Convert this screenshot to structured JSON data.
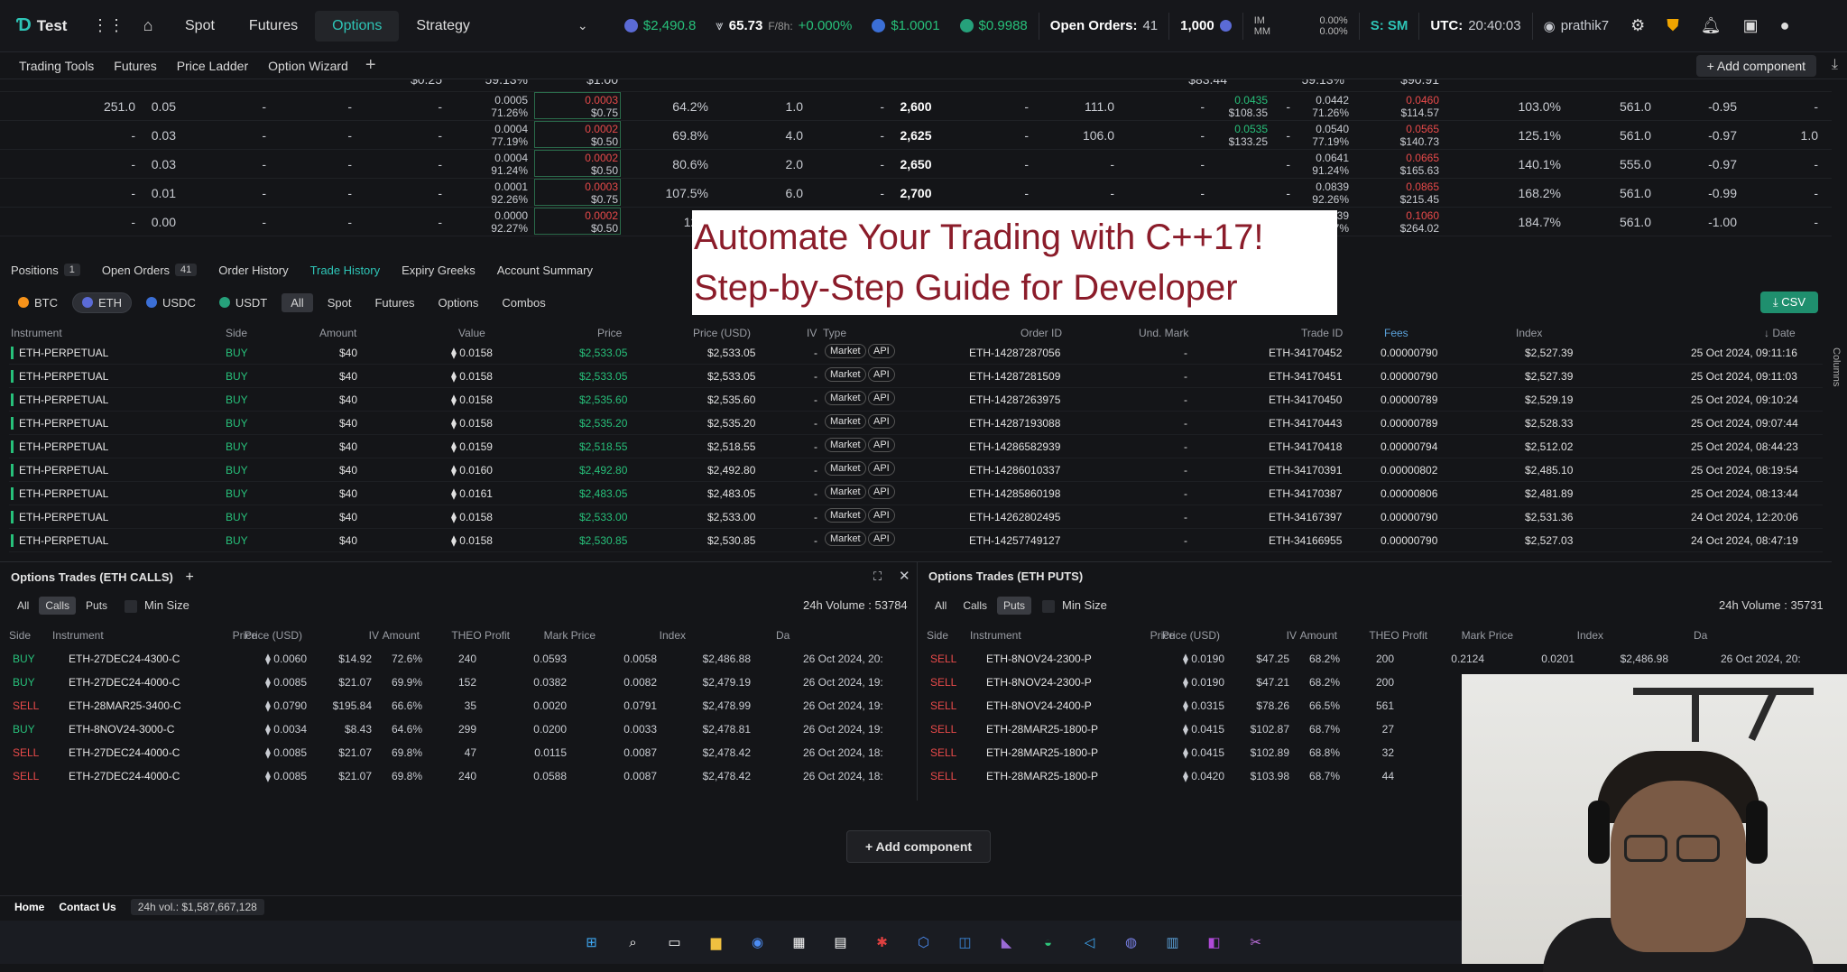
{
  "nav": {
    "logo": "Test",
    "links": [
      "Spot",
      "Futures",
      "Options",
      "Strategy"
    ],
    "active": "Options",
    "tickers": {
      "btc_price": "$2,490.8",
      "funding_label": "65.73",
      "funding_rate_label": "F/8h:",
      "funding_rate": "+0.000%",
      "usdc": "$1.0001",
      "usdt": "$0.9988"
    },
    "open_orders_label": "Open Orders:",
    "open_orders": "41",
    "size": "1,000",
    "im_label": "IM",
    "mm_label": "MM",
    "im": "0.00%",
    "mm": "0.00%",
    "s_label": "S: SM",
    "utc_label": "UTC:",
    "utc": "20:40:03",
    "user": "prathik7"
  },
  "toolbar": {
    "items": [
      "Trading Tools",
      "Futures",
      "Price Ladder",
      "Option Wizard"
    ],
    "add_component": "Add component"
  },
  "chain_rows": [
    {
      "bid_sz": "251.0",
      "bid": "0.05",
      "a": "-",
      "b": "-",
      "c": "-",
      "mark": "0.0005",
      "mark_iv": "71.26%",
      "ask": "0.0003",
      "ask_usd": "$0.75",
      "iv": "64.2%",
      "oi": "1.0",
      "d": "-",
      "strike": "2,600",
      "p1": "-",
      "p2": "111.0",
      "p3": "-",
      "p4": "-",
      "pbid": "0.0435",
      "pbid_usd": "$108.35",
      "pmark": "0.0442",
      "pmark_iv": "71.26%",
      "pask": "0.0460",
      "pask_usd": "$114.57",
      "piv": "103.0%",
      "poi": "561.0",
      "pdelta": "-0.95",
      "pe": "-"
    },
    {
      "bid_sz": "-",
      "bid": "0.03",
      "a": "-",
      "b": "-",
      "c": "-",
      "mark": "0.0004",
      "mark_iv": "77.19%",
      "ask": "0.0002",
      "ask_usd": "$0.50",
      "iv": "69.8%",
      "oi": "4.0",
      "d": "-",
      "strike": "2,625",
      "p1": "-",
      "p2": "106.0",
      "p3": "-",
      "p4": "-",
      "pbid": "0.0535",
      "pbid_usd": "$133.25",
      "pmark": "0.0540",
      "pmark_iv": "77.19%",
      "pask": "0.0565",
      "pask_usd": "$140.73",
      "piv": "125.1%",
      "poi": "561.0",
      "pdelta": "-0.97",
      "pe": "1.0"
    },
    {
      "bid_sz": "-",
      "bid": "0.03",
      "a": "-",
      "b": "-",
      "c": "-",
      "mark": "0.0004",
      "mark_iv": "91.24%",
      "ask": "0.0002",
      "ask_usd": "$0.50",
      "iv": "80.6%",
      "oi": "2.0",
      "d": "-",
      "strike": "2,650",
      "p1": "-",
      "p2": "-",
      "p3": "-",
      "p4": "-",
      "pbid": "",
      "pbid_usd": "",
      "pmark": "0.0641",
      "pmark_iv": "91.24%",
      "pask": "0.0665",
      "pask_usd": "$165.63",
      "piv": "140.1%",
      "poi": "555.0",
      "pdelta": "-0.97",
      "pe": "-"
    },
    {
      "bid_sz": "-",
      "bid": "0.01",
      "a": "-",
      "b": "-",
      "c": "-",
      "mark": "0.0001",
      "mark_iv": "92.26%",
      "ask": "0.0003",
      "ask_usd": "$0.75",
      "iv": "107.5%",
      "oi": "6.0",
      "d": "-",
      "strike": "2,700",
      "p1": "-",
      "p2": "-",
      "p3": "-",
      "p4": "-",
      "pbid": "",
      "pbid_usd": "",
      "pmark": "0.0839",
      "pmark_iv": "92.26%",
      "pask": "0.0865",
      "pask_usd": "$215.45",
      "piv": "168.2%",
      "poi": "561.0",
      "pdelta": "-0.99",
      "pe": "-"
    },
    {
      "bid_sz": "-",
      "bid": "0.00",
      "a": "-",
      "b": "-",
      "c": "-",
      "mark": "0.0000",
      "mark_iv": "92.27%",
      "ask": "0.0002",
      "ask_usd": "$0.50",
      "iv": "120.",
      "oi": "",
      "d": "",
      "strike": "",
      "p1": "",
      "p2": "",
      "p3": "",
      "p4": "",
      "pbid": "",
      "pbid_usd": "",
      "pmark": "0.1039",
      "pmark_iv": "92.27%",
      "pask": "0.1060",
      "pask_usd": "$264.02",
      "piv": "184.7%",
      "poi": "561.0",
      "pdelta": "-1.00",
      "pe": "-"
    }
  ],
  "chain_top_partial": {
    "a": "$0.25",
    "b": "59.13%",
    "c": "$1.00",
    "d": "$83.44",
    "e": "59.13%",
    "f": "$90.91"
  },
  "banner": {
    "line1": "Automate Your Trading with C++17!",
    "line2": "Step-by-Step Guide for Developer"
  },
  "panel_tabs": [
    {
      "label": "Positions",
      "badge": "1"
    },
    {
      "label": "Open Orders",
      "badge": "41"
    },
    {
      "label": "Order History"
    },
    {
      "label": "Trade History",
      "active": true
    },
    {
      "label": "Expiry Greeks"
    },
    {
      "label": "Account Summary"
    }
  ],
  "coin_chips": [
    "BTC",
    "ETH",
    "USDC",
    "USDT"
  ],
  "type_chips": [
    "All",
    "Spot",
    "Futures",
    "Options",
    "Combos"
  ],
  "csv_label": "CSV",
  "th_headers": {
    "instrument": "Instrument",
    "side": "Side",
    "amount": "Amount",
    "value": "Value",
    "price": "Price",
    "price_usd": "Price (USD)",
    "iv": "IV",
    "type": "Type",
    "order_id": "Order ID",
    "und_mark": "Und. Mark",
    "trade_id": "Trade ID",
    "fees": "Fees",
    "index": "Index",
    "date": "Date",
    "columns": "Columns"
  },
  "trades": [
    {
      "inst": "ETH-PERPETUAL",
      "side": "BUY",
      "amt": "$40",
      "val": "0.0158",
      "price": "$2,533.05",
      "usd": "$2,533.05",
      "iv": "-",
      "type": "Market",
      "api": "API",
      "oid": "ETH-14287287056",
      "und": "-",
      "tid": "ETH-34170452",
      "fees": "0.00000790",
      "index": "$2,527.39",
      "date": "25 Oct 2024, 09:11:16"
    },
    {
      "inst": "ETH-PERPETUAL",
      "side": "BUY",
      "amt": "$40",
      "val": "0.0158",
      "price": "$2,533.05",
      "usd": "$2,533.05",
      "iv": "-",
      "type": "Market",
      "api": "API",
      "oid": "ETH-14287281509",
      "und": "-",
      "tid": "ETH-34170451",
      "fees": "0.00000790",
      "index": "$2,527.39",
      "date": "25 Oct 2024, 09:11:03"
    },
    {
      "inst": "ETH-PERPETUAL",
      "side": "BUY",
      "amt": "$40",
      "val": "0.0158",
      "price": "$2,535.60",
      "usd": "$2,535.60",
      "iv": "-",
      "type": "Market",
      "api": "API",
      "oid": "ETH-14287263975",
      "und": "-",
      "tid": "ETH-34170450",
      "fees": "0.00000789",
      "index": "$2,529.19",
      "date": "25 Oct 2024, 09:10:24"
    },
    {
      "inst": "ETH-PERPETUAL",
      "side": "BUY",
      "amt": "$40",
      "val": "0.0158",
      "price": "$2,535.20",
      "usd": "$2,535.20",
      "iv": "-",
      "type": "Market",
      "api": "API",
      "oid": "ETH-14287193088",
      "und": "-",
      "tid": "ETH-34170443",
      "fees": "0.00000789",
      "index": "$2,528.33",
      "date": "25 Oct 2024, 09:07:44"
    },
    {
      "inst": "ETH-PERPETUAL",
      "side": "BUY",
      "amt": "$40",
      "val": "0.0159",
      "price": "$2,518.55",
      "usd": "$2,518.55",
      "iv": "-",
      "type": "Market",
      "api": "API",
      "oid": "ETH-14286582939",
      "und": "-",
      "tid": "ETH-34170418",
      "fees": "0.00000794",
      "index": "$2,512.02",
      "date": "25 Oct 2024, 08:44:23"
    },
    {
      "inst": "ETH-PERPETUAL",
      "side": "BUY",
      "amt": "$40",
      "val": "0.0160",
      "price": "$2,492.80",
      "usd": "$2,492.80",
      "iv": "-",
      "type": "Market",
      "api": "API",
      "oid": "ETH-14286010337",
      "und": "-",
      "tid": "ETH-34170391",
      "fees": "0.00000802",
      "index": "$2,485.10",
      "date": "25 Oct 2024, 08:19:54"
    },
    {
      "inst": "ETH-PERPETUAL",
      "side": "BUY",
      "amt": "$40",
      "val": "0.0161",
      "price": "$2,483.05",
      "usd": "$2,483.05",
      "iv": "-",
      "type": "Market",
      "api": "API",
      "oid": "ETH-14285860198",
      "und": "-",
      "tid": "ETH-34170387",
      "fees": "0.00000806",
      "index": "$2,481.89",
      "date": "25 Oct 2024, 08:13:44"
    },
    {
      "inst": "ETH-PERPETUAL",
      "side": "BUY",
      "amt": "$40",
      "val": "0.0158",
      "price": "$2,533.00",
      "usd": "$2,533.00",
      "iv": "-",
      "type": "Market",
      "api": "API",
      "oid": "ETH-14262802495",
      "und": "-",
      "tid": "ETH-34167397",
      "fees": "0.00000790",
      "index": "$2,531.36",
      "date": "24 Oct 2024, 12:20:06"
    },
    {
      "inst": "ETH-PERPETUAL",
      "side": "BUY",
      "amt": "$40",
      "val": "0.0158",
      "price": "$2,530.85",
      "usd": "$2,530.85",
      "iv": "-",
      "type": "Market",
      "api": "API",
      "oid": "ETH-14257749127",
      "und": "-",
      "tid": "ETH-34166955",
      "fees": "0.00000790",
      "index": "$2,527.03",
      "date": "24 Oct 2024, 08:47:19"
    }
  ],
  "calls_panel": {
    "title": "Options Trades (ETH CALLS)",
    "seg": [
      "All",
      "Calls",
      "Puts"
    ],
    "selected": "Calls",
    "min_size": "Min Size",
    "vol": "24h Volume : 53784",
    "headers": [
      "Side",
      "Instrument",
      "Price",
      "Price (USD)",
      "IV",
      "Amount",
      "THEO Profit",
      "Mark Price",
      "Index",
      "Da"
    ],
    "rows": [
      [
        "BUY",
        "ETH-27DEC24-4300-C",
        "0.0060",
        "$14.92",
        "72.6%",
        "240",
        "0.0593",
        "0.0058",
        "$2,486.88",
        "26 Oct 2024, 20:"
      ],
      [
        "BUY",
        "ETH-27DEC24-4000-C",
        "0.0085",
        "$21.07",
        "69.9%",
        "152",
        "0.0382",
        "0.0082",
        "$2,479.19",
        "26 Oct 2024, 19:"
      ],
      [
        "SELL",
        "ETH-28MAR25-3400-C",
        "0.0790",
        "$195.84",
        "66.6%",
        "35",
        "0.0020",
        "0.0791",
        "$2,478.99",
        "26 Oct 2024, 19:"
      ],
      [
        "BUY",
        "ETH-8NOV24-3000-C",
        "0.0034",
        "$8.43",
        "64.6%",
        "299",
        "0.0200",
        "0.0033",
        "$2,478.81",
        "26 Oct 2024, 19:"
      ],
      [
        "SELL",
        "ETH-27DEC24-4000-C",
        "0.0085",
        "$21.07",
        "69.8%",
        "47",
        "0.0115",
        "0.0087",
        "$2,478.42",
        "26 Oct 2024, 18:"
      ],
      [
        "SELL",
        "ETH-27DEC24-4000-C",
        "0.0085",
        "$21.07",
        "69.8%",
        "240",
        "0.0588",
        "0.0087",
        "$2,478.42",
        "26 Oct 2024, 18:"
      ]
    ]
  },
  "puts_panel": {
    "title": "Options Trades (ETH PUTS)",
    "seg": [
      "All",
      "Calls",
      "Puts"
    ],
    "selected": "Puts",
    "min_size": "Min Size",
    "vol": "24h Volume : 35731",
    "headers": [
      "Side",
      "Instrument",
      "Price",
      "Price (USD)",
      "IV",
      "Amount",
      "THEO Profit",
      "Mark Price",
      "Index",
      "Da"
    ],
    "rows": [
      [
        "SELL",
        "ETH-8NOV24-2300-P",
        "0.0190",
        "$47.25",
        "68.2%",
        "200",
        "0.2124",
        "0.0201",
        "$2,486.98",
        "26 Oct 2024, 20:"
      ],
      [
        "SELL",
        "ETH-8NOV24-2300-P",
        "0.0190",
        "$47.21",
        "68.2%",
        "200",
        "0.",
        "",
        "",
        ""
      ],
      [
        "SELL",
        "ETH-8NOV24-2400-P",
        "0.0315",
        "$78.26",
        "66.5%",
        "561",
        "0.5",
        "",
        "",
        ""
      ],
      [
        "SELL",
        "ETH-28MAR25-1800-P",
        "0.0415",
        "$102.87",
        "68.7%",
        "27",
        "0.0",
        "",
        "",
        ""
      ],
      [
        "SELL",
        "ETH-28MAR25-1800-P",
        "0.0415",
        "$102.89",
        "68.8%",
        "32",
        "0.0",
        "",
        "",
        ""
      ],
      [
        "SELL",
        "ETH-28MAR25-1800-P",
        "0.0420",
        "$103.98",
        "68.7%",
        "44",
        "0.0",
        "",
        "",
        ""
      ]
    ]
  },
  "add_component_bottom": "Add component",
  "status": {
    "home": "Home",
    "contact": "Contact Us",
    "vol": "24h vol.: $1,587,667,128"
  }
}
